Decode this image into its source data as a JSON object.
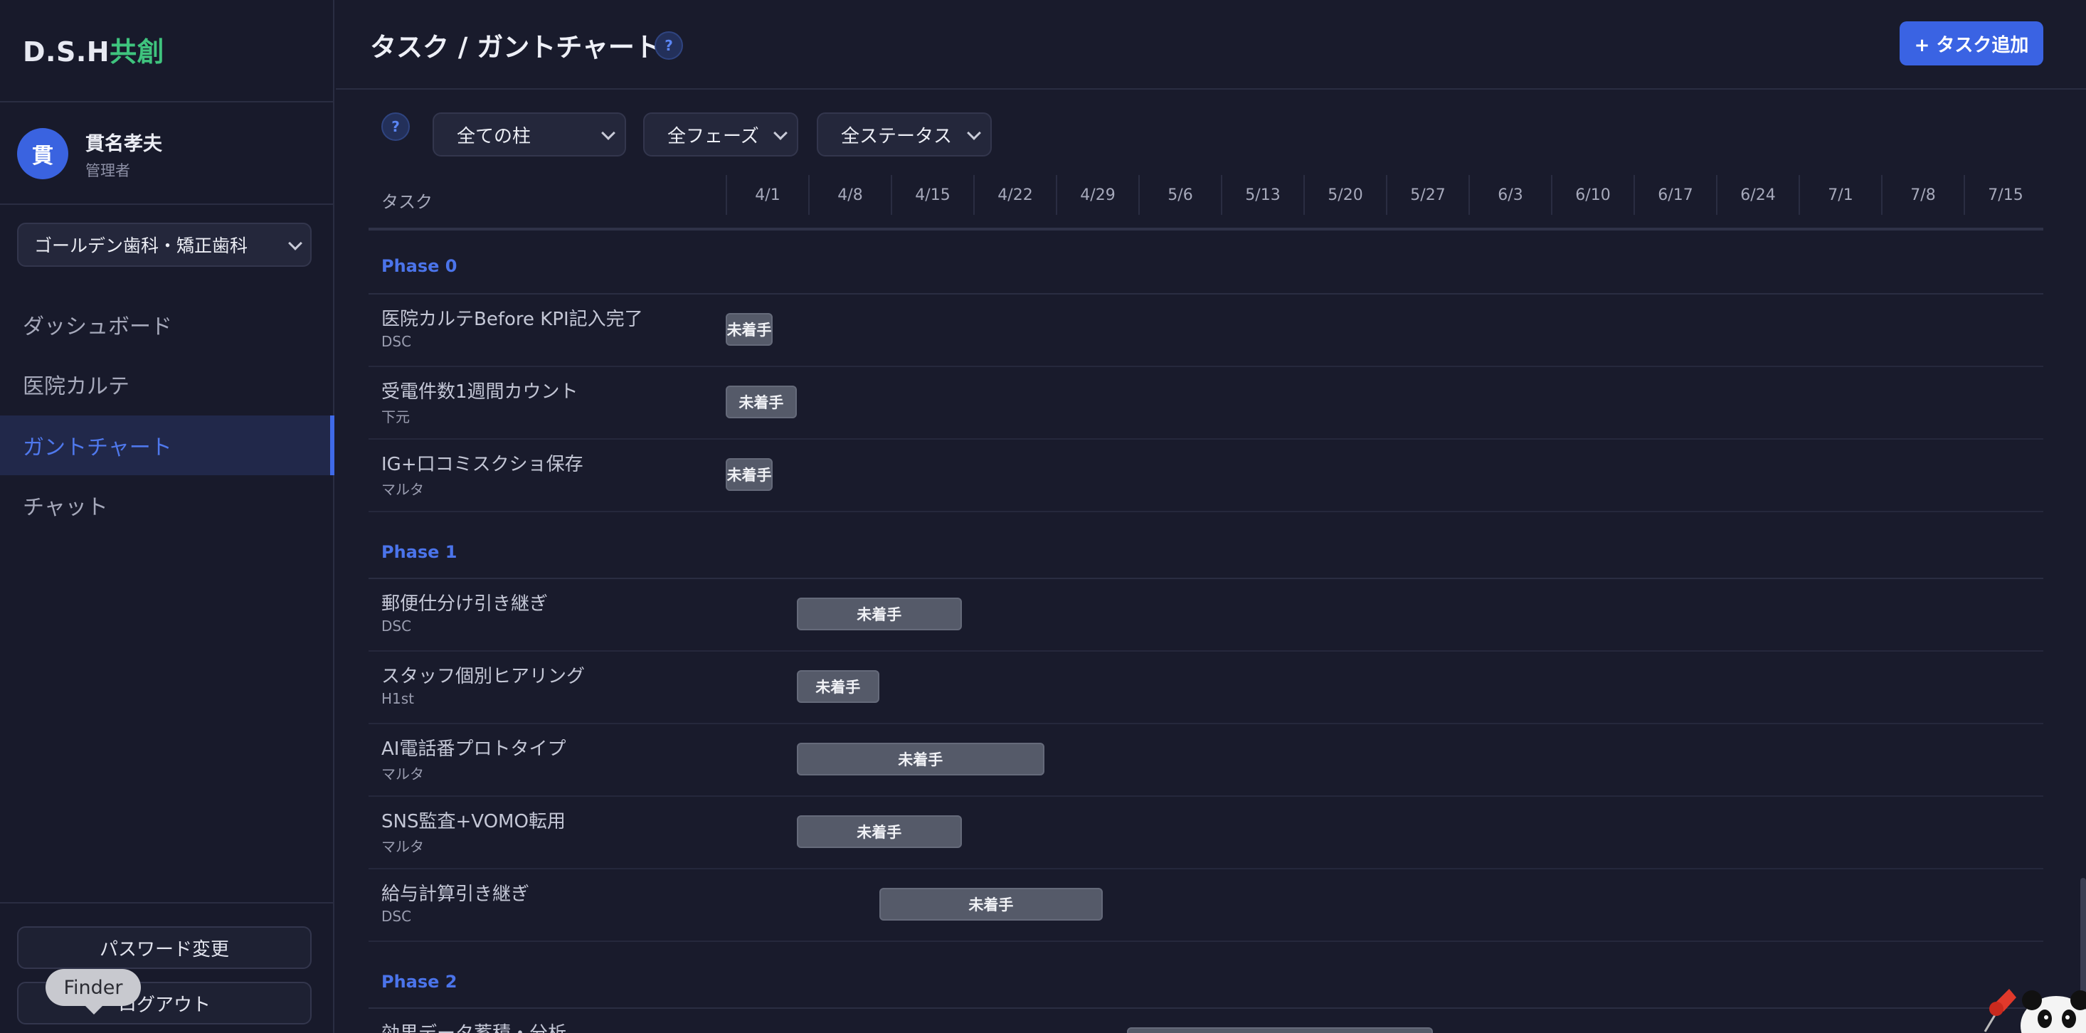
{
  "sidebar": {
    "brand_part1": "D.S.H",
    "brand_part2": "共創",
    "user_initial": "貫",
    "user_name": "貫名孝夫",
    "user_role": "管理者",
    "clinic": "ゴールデン歯科・矯正歯科",
    "nav": [
      "ダッシュボード",
      "医院カルテ",
      "ガントチャート",
      "チャット"
    ],
    "active_nav": "ガントチャート",
    "password_btn": "パスワード変更",
    "logout_btn": "ログアウト",
    "tooltip": "Finder"
  },
  "header": {
    "title": "タスク / ガントチャート",
    "help": "?",
    "add_task": "+ タスク追加"
  },
  "filters": {
    "help": "?",
    "pillar": "全ての柱",
    "phase": "全フェーズ",
    "status": "全ステータス"
  },
  "gantt": {
    "task_col": "タスク",
    "dates": [
      "4/1",
      "4/8",
      "4/15",
      "4/22",
      "4/29",
      "5/6",
      "5/13",
      "5/20",
      "5/27",
      "6/3",
      "6/10",
      "6/17",
      "6/24",
      "7/1",
      "7/8",
      "7/15"
    ],
    "phases": [
      {
        "name": "Phase 0",
        "tasks": [
          {
            "name": "医院カルテBefore KPI記入完了",
            "owner": "DSC",
            "status": "未着手",
            "start_week": 0,
            "span_weeks": 0.57
          },
          {
            "name": "受電件数1週間カウント",
            "owner": "下元",
            "status": "未着手",
            "start_week": 0,
            "span_weeks": 0.86
          },
          {
            "name": "IG+口コミスクショ保存",
            "owner": "マルタ",
            "status": "未着手",
            "start_week": 0,
            "span_weeks": 0.57
          }
        ]
      },
      {
        "name": "Phase 1",
        "tasks": [
          {
            "name": "郵便仕分け引き継ぎ",
            "owner": "DSC",
            "status": "未着手",
            "start_week": 0.86,
            "span_weeks": 2.0
          },
          {
            "name": "スタッフ個別ヒアリング",
            "owner": "H1st",
            "status": "未着手",
            "start_week": 0.86,
            "span_weeks": 1.0
          },
          {
            "name": "AI電話番プロトタイプ",
            "owner": "マルタ",
            "status": "未着手",
            "start_week": 0.86,
            "span_weeks": 3.0
          },
          {
            "name": "SNS監査+VOMO転用",
            "owner": "マルタ",
            "status": "未着手",
            "start_week": 0.86,
            "span_weeks": 2.0
          },
          {
            "name": "給与計算引き継ぎ",
            "owner": "DSC",
            "status": "未着手",
            "start_week": 1.86,
            "span_weeks": 2.71
          }
        ]
      },
      {
        "name": "Phase 2",
        "tasks": [
          {
            "name": "効果データ蓄積・分析",
            "owner": "",
            "status": "未着手",
            "start_week": 4.86,
            "span_weeks": 3.71
          }
        ]
      }
    ]
  },
  "colors": {
    "accent": "#3a63e3",
    "brand_green": "#3fc47e",
    "bar_not_started": "#555a69"
  }
}
